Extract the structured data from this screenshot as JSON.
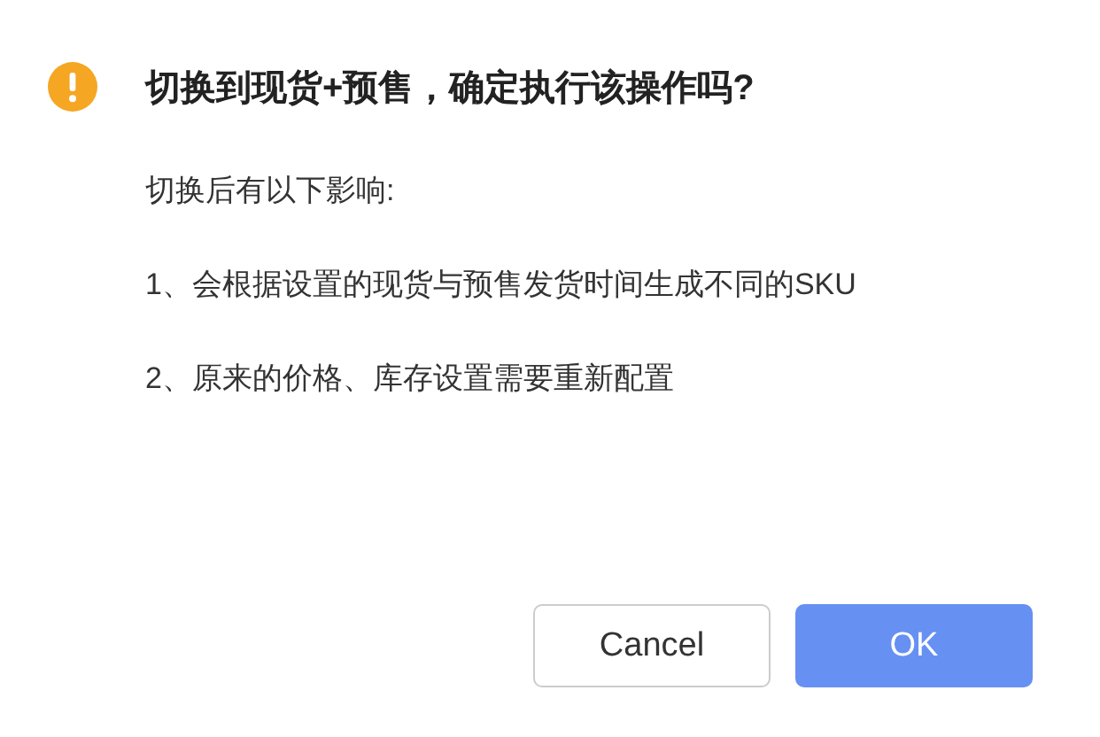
{
  "dialog": {
    "title": "切换到现货+预售，确定执行该操作吗?",
    "paragraphs": [
      "切换后有以下影响:",
      "1、会根据设置的现货与预售发货时间生成不同的SKU",
      "2、原来的价格、库存设置需要重新配置"
    ],
    "buttons": [
      {
        "label": "Cancel",
        "kind": "secondary"
      },
      {
        "label": "OK",
        "kind": "primary"
      }
    ]
  }
}
